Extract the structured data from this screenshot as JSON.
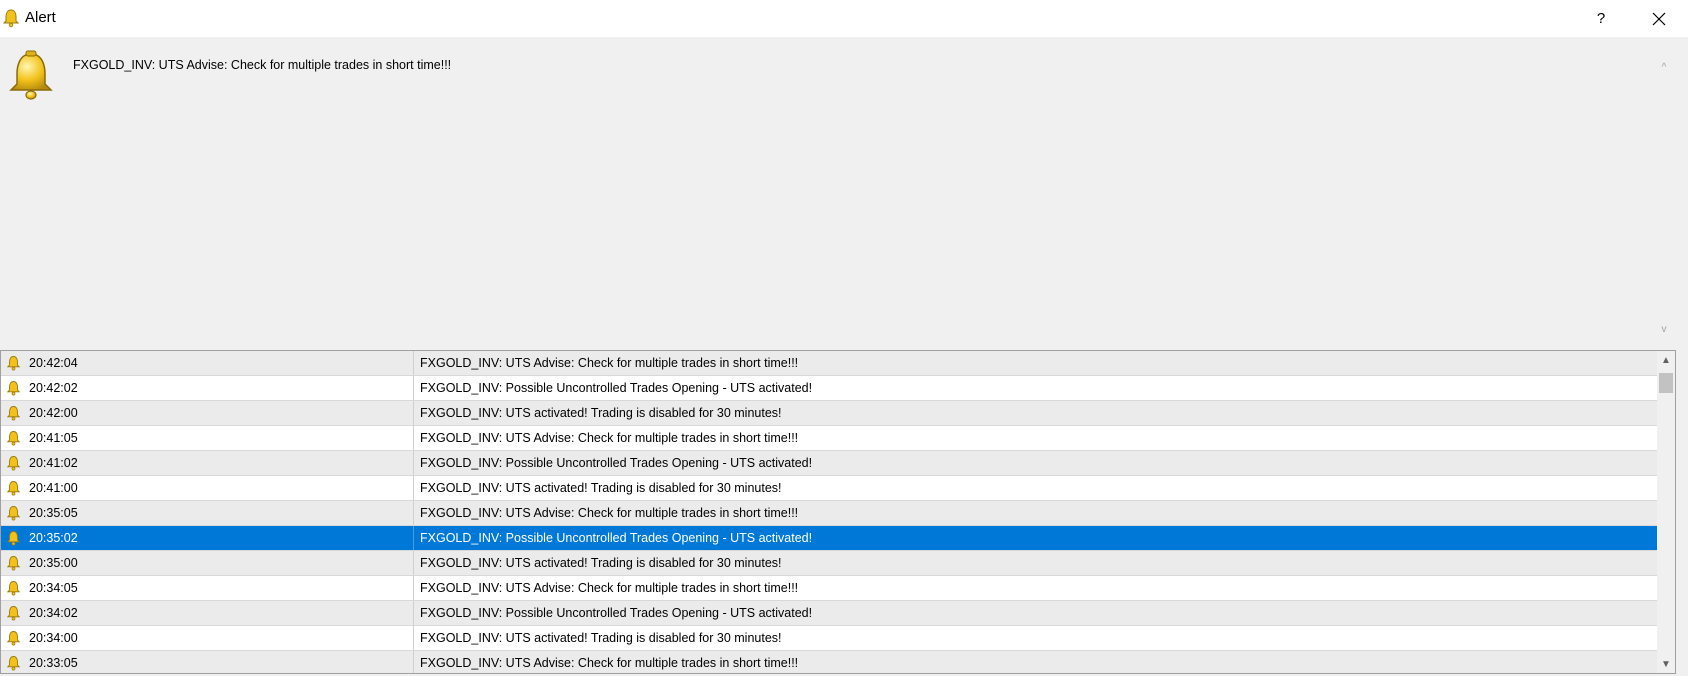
{
  "window": {
    "title": "Alert",
    "help_label": "?",
    "close_label": "✕"
  },
  "message": {
    "text": "FXGOLD_INV: UTS Advise: Check for multiple trades in short time!!!"
  },
  "scroll": {
    "up": "^",
    "down": "v",
    "up_tri": "▲",
    "down_tri": "▼"
  },
  "alerts": [
    {
      "time": "20:42:04",
      "message": "FXGOLD_INV: UTS Advise: Check for multiple trades in short time!!!"
    },
    {
      "time": "20:42:02",
      "message": "FXGOLD_INV: Possible Uncontrolled Trades Opening - UTS activated!"
    },
    {
      "time": "20:42:00",
      "message": "FXGOLD_INV: UTS activated! Trading is disabled for 30 minutes!"
    },
    {
      "time": "20:41:05",
      "message": "FXGOLD_INV: UTS Advise: Check for multiple trades in short time!!!"
    },
    {
      "time": "20:41:02",
      "message": "FXGOLD_INV: Possible Uncontrolled Trades Opening - UTS activated!"
    },
    {
      "time": "20:41:00",
      "message": "FXGOLD_INV: UTS activated! Trading is disabled for 30 minutes!"
    },
    {
      "time": "20:35:05",
      "message": "FXGOLD_INV: UTS Advise: Check for multiple trades in short time!!!"
    },
    {
      "time": "20:35:02",
      "message": "FXGOLD_INV: Possible Uncontrolled Trades Opening - UTS activated!"
    },
    {
      "time": "20:35:00",
      "message": "FXGOLD_INV: UTS activated! Trading is disabled for 30 minutes!"
    },
    {
      "time": "20:34:05",
      "message": "FXGOLD_INV: UTS Advise: Check for multiple trades in short time!!!"
    },
    {
      "time": "20:34:02",
      "message": "FXGOLD_INV: Possible Uncontrolled Trades Opening - UTS activated!"
    },
    {
      "time": "20:34:00",
      "message": "FXGOLD_INV: UTS activated! Trading is disabled for 30 minutes!"
    },
    {
      "time": "20:33:05",
      "message": "FXGOLD_INV: UTS Advise: Check for multiple trades in short time!!!"
    }
  ],
  "selected_index": 7,
  "colors": {
    "selection": "#0078d7",
    "bell_fill": "#f2c21b",
    "bell_stroke": "#9a7a10"
  }
}
